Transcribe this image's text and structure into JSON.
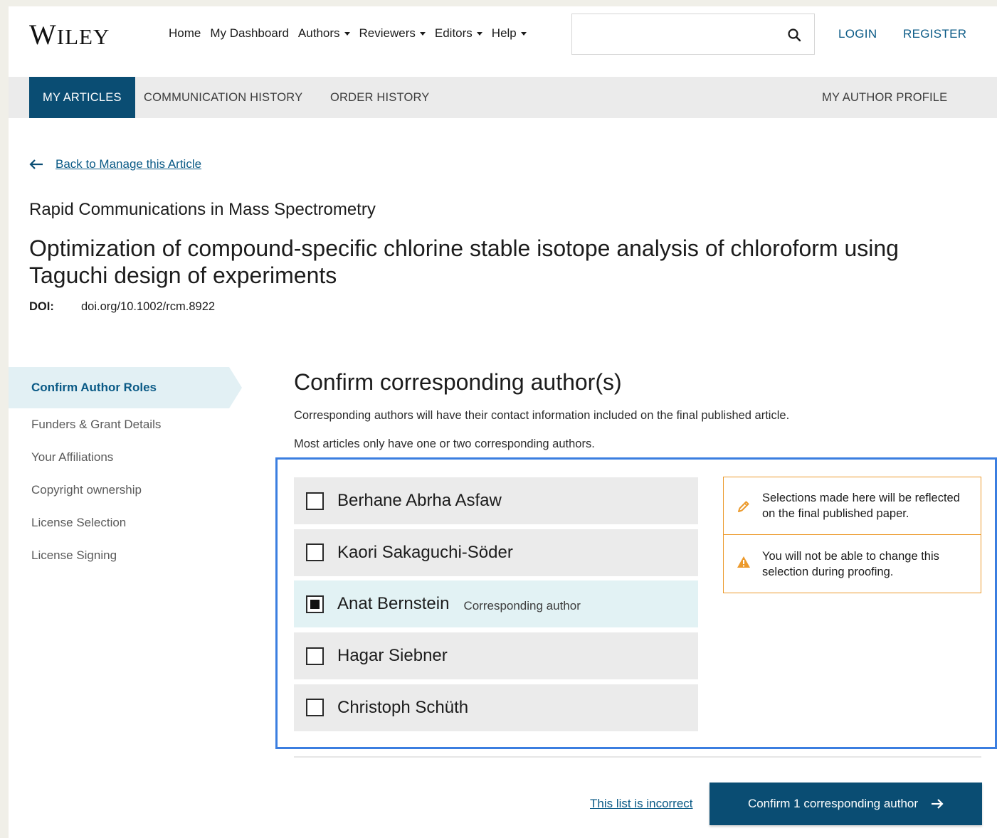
{
  "header": {
    "logo": "Wiley",
    "nav": [
      {
        "label": "Home",
        "dropdown": false
      },
      {
        "label": "My Dashboard",
        "dropdown": false
      },
      {
        "label": "Authors",
        "dropdown": true
      },
      {
        "label": "Reviewers",
        "dropdown": true
      },
      {
        "label": "Editors",
        "dropdown": true
      },
      {
        "label": "Help",
        "dropdown": true
      }
    ],
    "search": {
      "value": "",
      "placeholder": ""
    },
    "login": "LOGIN",
    "register": "REGISTER"
  },
  "tabs": {
    "my_articles": "MY ARTICLES",
    "communication_history": "COMMUNICATION HISTORY",
    "order_history": "ORDER HISTORY",
    "my_author_profile": "MY AUTHOR PROFILE",
    "active": "my_articles"
  },
  "article": {
    "back_link": "Back to Manage this Article",
    "journal": "Rapid Communications in Mass Spectrometry",
    "title": "Optimization of compound-specific chlorine stable isotope analysis of chloroform using Taguchi design of experiments",
    "doi_label": "DOI:",
    "doi_value": "doi.org/10.1002/rcm.8922"
  },
  "steps": [
    {
      "label": "Confirm Author Roles",
      "active": true
    },
    {
      "label": "Funders & Grant Details",
      "active": false
    },
    {
      "label": "Your Affiliations",
      "active": false
    },
    {
      "label": "Copyright ownership",
      "active": false
    },
    {
      "label": "License Selection",
      "active": false
    },
    {
      "label": "License Signing",
      "active": false
    }
  ],
  "panel": {
    "title": "Confirm corresponding author(s)",
    "desc1": "Corresponding authors will have their contact information included on the final published article.",
    "desc2": "Most articles only have one or two corresponding authors.",
    "authors": [
      {
        "name": "Berhane Abrha Asfaw",
        "checked": false,
        "tag": ""
      },
      {
        "name": "Kaori Sakaguchi-Söder",
        "checked": false,
        "tag": ""
      },
      {
        "name": "Anat Bernstein",
        "checked": true,
        "tag": "Corresponding author"
      },
      {
        "name": "Hagar Siebner",
        "checked": false,
        "tag": ""
      },
      {
        "name": "Christoph Schüth",
        "checked": false,
        "tag": ""
      }
    ],
    "notices": [
      {
        "icon": "pencil-icon",
        "text": "Selections made here will be reflected on the final published paper."
      },
      {
        "icon": "warning-icon",
        "text": "You will not be able to change this selection during proofing."
      }
    ],
    "incorrect_link": "This list is incorrect",
    "confirm_button": "Confirm 1 corresponding author"
  },
  "colors": {
    "brand_dark": "#0a4d73",
    "link": "#0a5a86",
    "selected_bg": "#e2f2f4",
    "warning": "#ec9a2c",
    "highlight_border": "#3b7ee0"
  }
}
